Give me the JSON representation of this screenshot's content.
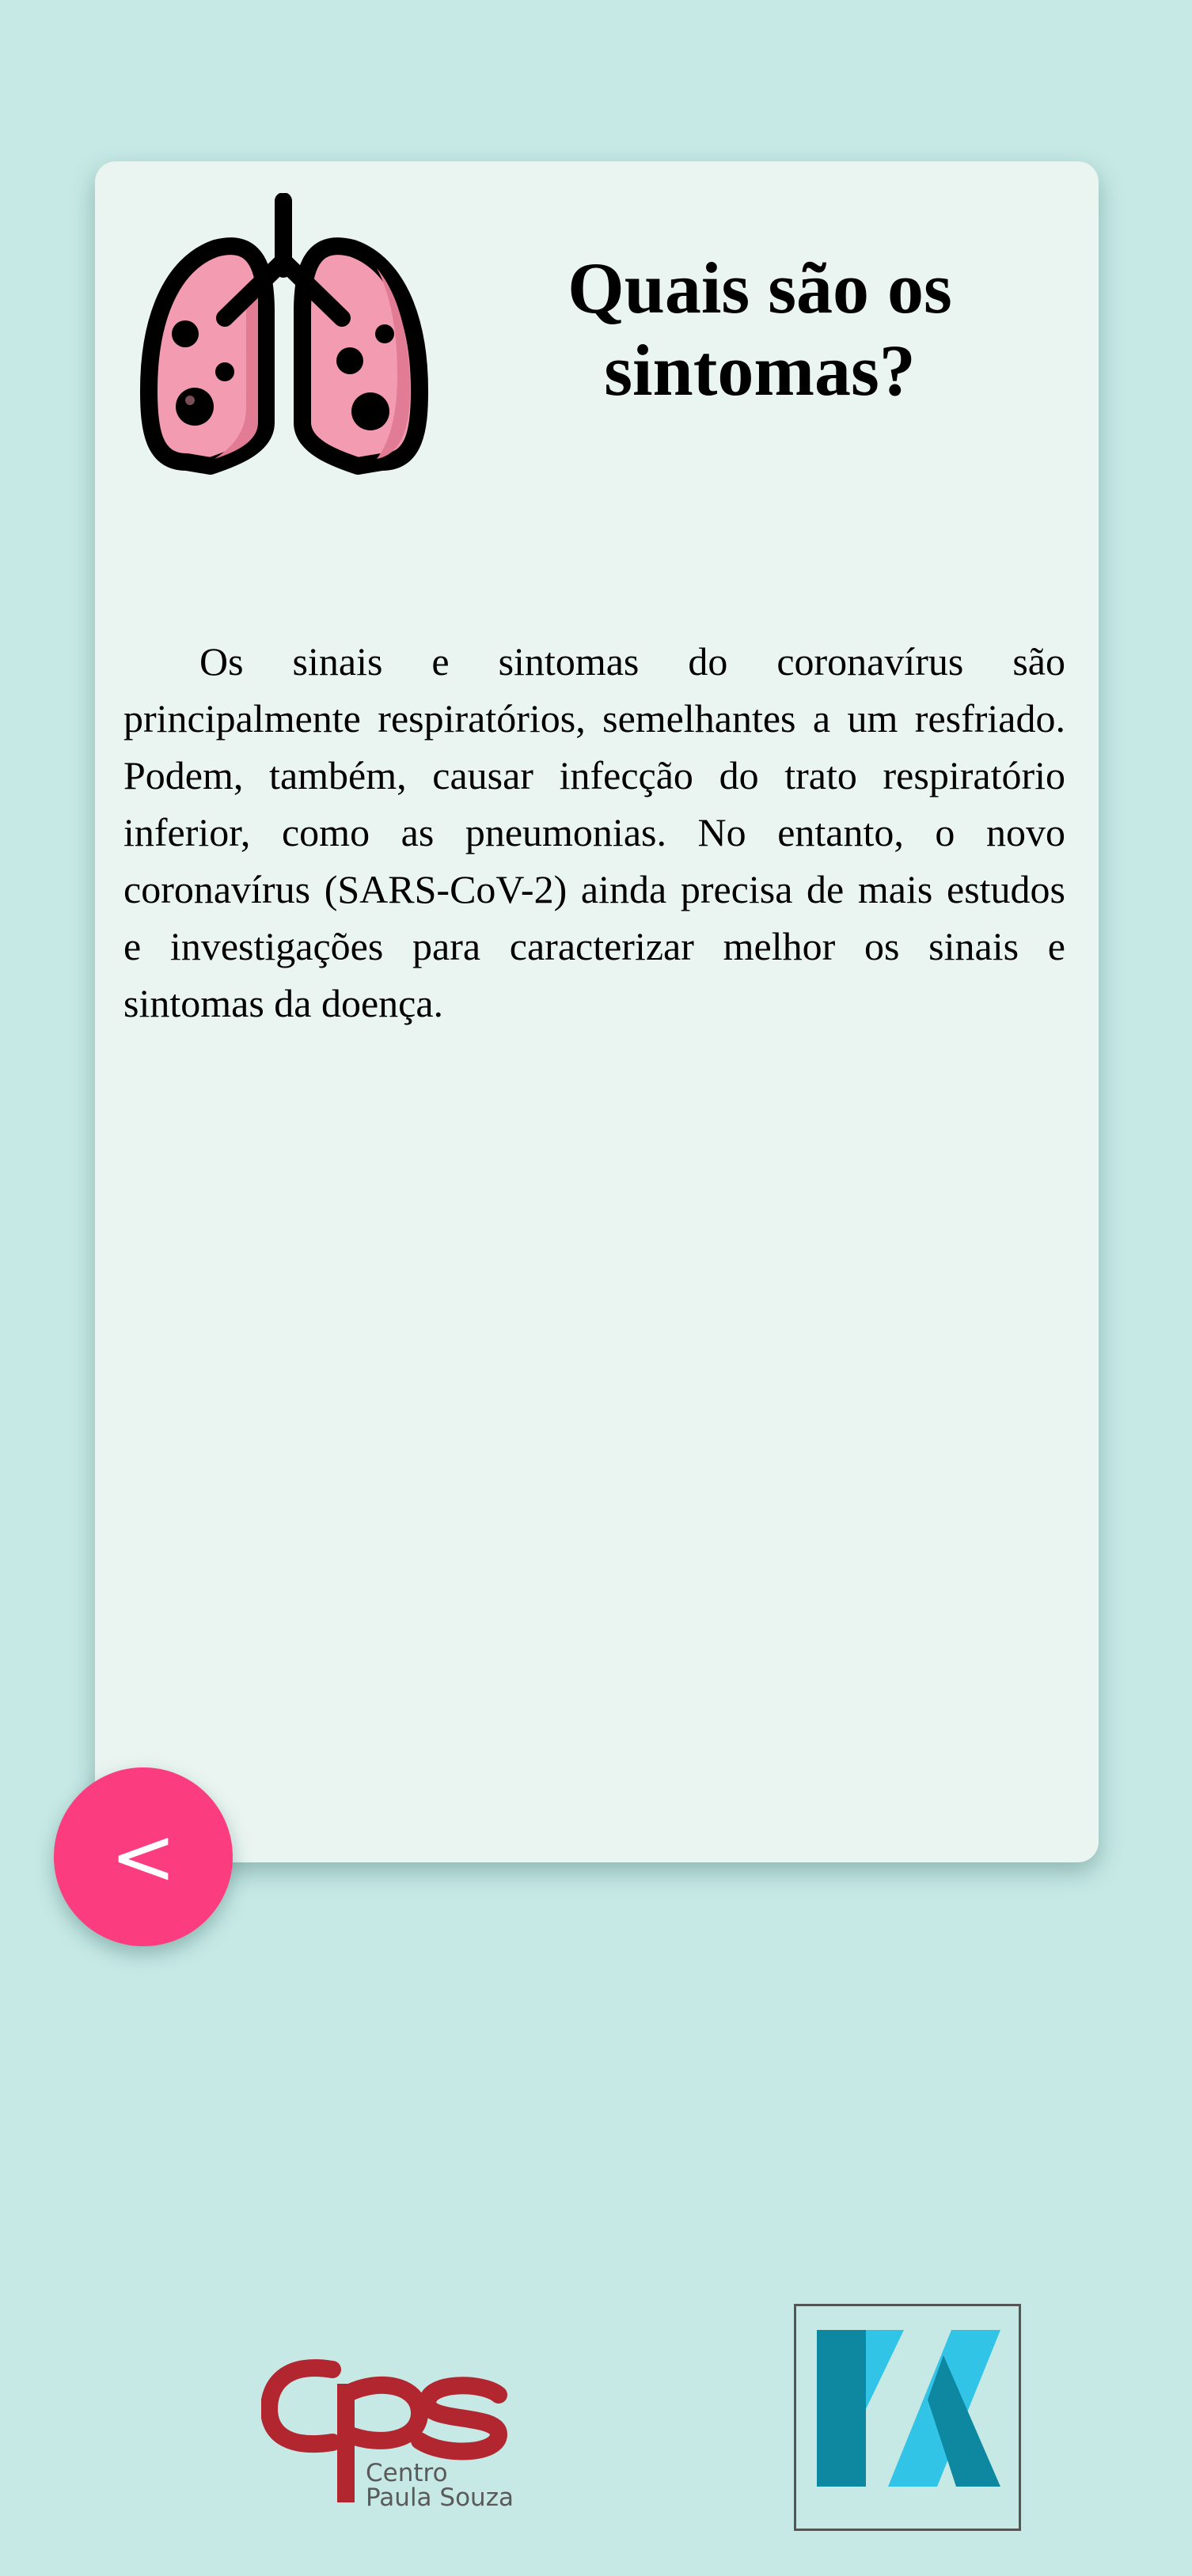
{
  "card": {
    "title": "Quais são os sintomas?",
    "body": "Os sinais e sintomas do coronavírus são principalmente respiratórios, semelhantes a um resfriado. Podem, também, causar infecção do trato respiratório inferior, como as pneumonias. No entanto, o novo coronavírus (SARS-CoV-2) ainda precisa de mais estudos e investigações para caracterizar melhor os sinais e sintomas da doença.",
    "icon": "lungs-icon"
  },
  "navigation": {
    "back_label": "<",
    "back_color": "#fb3c7e"
  },
  "footer": {
    "cps_logo_text": "Centro\nPaula Souza",
    "cps_color": "#b1262f",
    "partner_logo": "k-logo"
  },
  "colors": {
    "background": "#c6e9e5",
    "card": "#eaf5f1"
  }
}
